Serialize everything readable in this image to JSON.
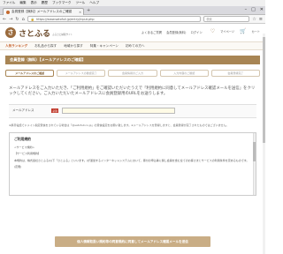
{
  "browser": {
    "menu": [
      "ファイル",
      "編集",
      "表示",
      "履歴",
      "ブックマーク",
      "ツール",
      "ヘルプ"
    ],
    "tab_title": "会員登録【無料】メールアドレスのご確認",
    "url": "https://www.satofull.jp/entry/input.php",
    "search_placeholder": "検索"
  },
  "site": {
    "logo_text": "さとふる",
    "logo_sub": "ふるさと納税サイト",
    "head_links": [
      "よくあるご質問",
      "会員登録(無料)",
      "ログイン"
    ],
    "mypage": "マイページ",
    "cart": "カート",
    "nav": [
      "人気ランキング",
      "お礼品から探す",
      "地域から探す",
      "特集・キャンペーン",
      "初めての方へ"
    ]
  },
  "page": {
    "banner": "会員登録（無料）【メールアドレスのご確認】",
    "steps": [
      "メールアドレスのご確認",
      "メールアドレスの確認完了",
      "会員情報のご入力",
      "入力内容のご確認",
      "会員登録完了"
    ],
    "lead": "メールアドレスをご入力いただき、「ご利用規約」をご確認いただいたうえで「利用規約に同意してメールアドレス確認メールを送信」をクリックしてください。ご入力いただいたメールアドレスに会員登録用のURLをお送りします。",
    "email_label": "メールアドレス",
    "required": "必須",
    "email_placeholder": "",
    "note": "※携帯電話でドメイン指定受信をされている場合は「@satofull.co.jp」の受信設定をお願い致します。※メールアドレスを登録しますと、会員登録が完了されたものではございません。",
    "terms_title": "ご利用規約",
    "terms_lines": [
      "<サービス規約>",
      "【サービス利用規約】",
      "本規約は、株式会社さとふる(以下「さとふる」といいます。)が運営するインターネットシステムにおいて、寄付の申込等に関し会員を含む全てのお客さまとサービスの利用条件を定めるものです。",
      "(定義)"
    ],
    "submit": "個人情報取扱い規約等の同意規約に同意してメールアドレス確認メールを送信"
  }
}
